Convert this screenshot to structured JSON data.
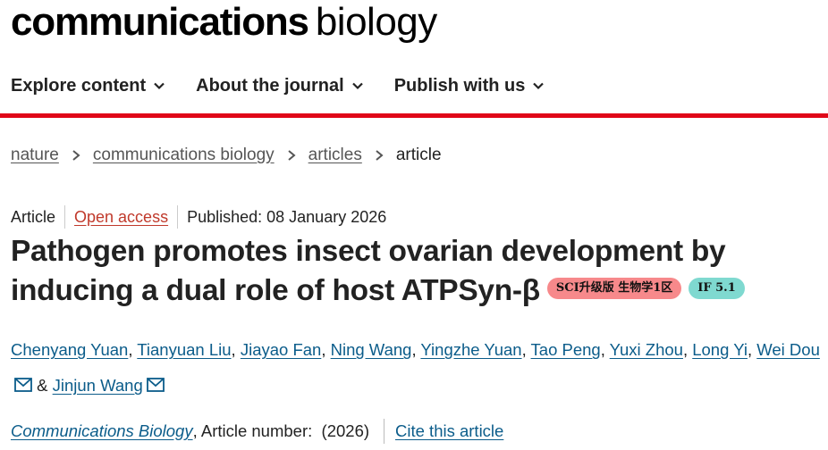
{
  "header": {
    "logo_bold": "communications",
    "logo_light": "biology"
  },
  "nav": {
    "items": [
      {
        "label": "Explore content"
      },
      {
        "label": "About the journal"
      },
      {
        "label": "Publish with us"
      }
    ]
  },
  "breadcrumb": {
    "items": [
      "nature",
      "communications biology",
      "articles"
    ],
    "current": "article"
  },
  "meta": {
    "type": "Article",
    "access": "Open access",
    "published": "Published: 08 January 2026"
  },
  "article": {
    "title_line1": "Pathogen promotes insect ovarian development by",
    "title_line2": "inducing a dual role of host ATPSyn-β",
    "badge_sci": "SCI升级版 生物学1区",
    "badge_if": "IF 5.1"
  },
  "authors": [
    "Chenyang Yuan",
    "Tianyuan Liu",
    "Jiayao Fan",
    "Ning Wang",
    "Yingzhe Yuan",
    "Tao Peng",
    "Yuxi Zhou",
    "Long Yi",
    "Wei Dou",
    "Jinjun Wang"
  ],
  "citation": {
    "journal": "Communications Biology",
    "article_number": ", Article number:  (2026)",
    "cite_label": "Cite this article"
  },
  "colors": {
    "accent_red": "#e00718",
    "link_blue": "#0b5c8a",
    "badge_sci_bg": "#f7898b",
    "badge_if_bg": "#7fd9d0"
  },
  "icons": {
    "nav_chevron": "chevron-down-icon",
    "breadcrumb_sep": "chevron-right-icon",
    "email": "mail-icon"
  }
}
